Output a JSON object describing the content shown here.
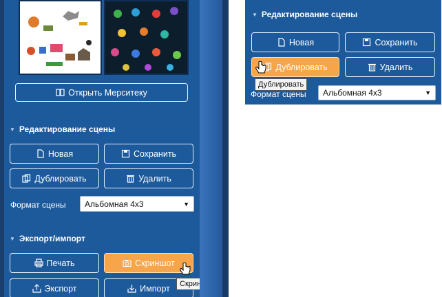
{
  "left": {
    "open_button": "Открыть Мерситеку",
    "edit_section_title": "Редактирование сцены",
    "new_button": "Новая",
    "save_button": "Сохранить",
    "duplicate_button": "Дублировать",
    "delete_button": "Удалить",
    "format_label": "Формат сцены",
    "format_value": "Альбомная 4x3",
    "export_section_title": "Экспорт/импорт",
    "print_button": "Печать",
    "screenshot_button": "Скриншот",
    "export_button": "Экспорт",
    "import_button": "Импорт",
    "tooltip": "Скриншот"
  },
  "right": {
    "edit_section_title": "Редактирование сцены",
    "new_button": "Новая",
    "save_button": "Сохранить",
    "duplicate_button": "Дублировать",
    "delete_button": "Удалить",
    "format_label": "Формат сцены",
    "format_value": "Альбомная 4x3",
    "tooltip": "Дублировать"
  },
  "colors": {
    "panel_bg": "#1d5a9c",
    "button_border": "#e7f0fa",
    "highlight_orange": "#f6a54a"
  },
  "icons": {
    "open": "book-icon",
    "new": "file-icon",
    "save": "floppy-icon",
    "duplicate": "copy-icon",
    "delete": "trash-icon",
    "print": "printer-icon",
    "screenshot": "camera-icon",
    "export": "upload-icon",
    "import": "download-icon",
    "chevron": "chevron-down-icon",
    "cursor": "hand-cursor-icon"
  }
}
